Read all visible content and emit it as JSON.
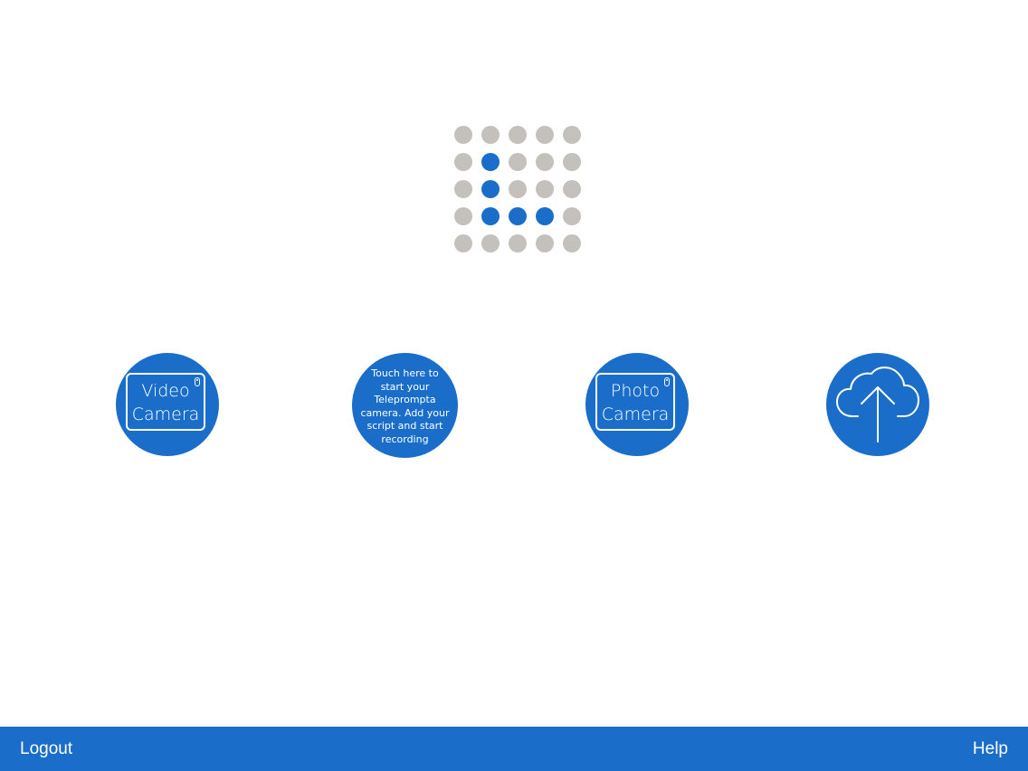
{
  "colors": {
    "accent": "#1a6ec9",
    "dot_inactive": "#c4c1bc",
    "background": "#ffffff"
  },
  "logo": {
    "rows": 5,
    "cols": 5,
    "active": [
      [
        1,
        1
      ],
      [
        2,
        1
      ],
      [
        3,
        1
      ],
      [
        3,
        2
      ],
      [
        3,
        3
      ]
    ]
  },
  "actions": {
    "video": {
      "label": "Video\nCamera",
      "icon": "video-camera-icon"
    },
    "teleprompta": {
      "text": "Touch here to\nstart your\nTeleprompta\ncamera. Add your\nscript and start\nrecording"
    },
    "photo": {
      "label": "Photo\nCamera",
      "icon": "photo-camera-icon"
    },
    "upload": {
      "icon": "cloud-upload-icon"
    }
  },
  "footer": {
    "logout_label": "Logout",
    "help_label": "Help"
  }
}
